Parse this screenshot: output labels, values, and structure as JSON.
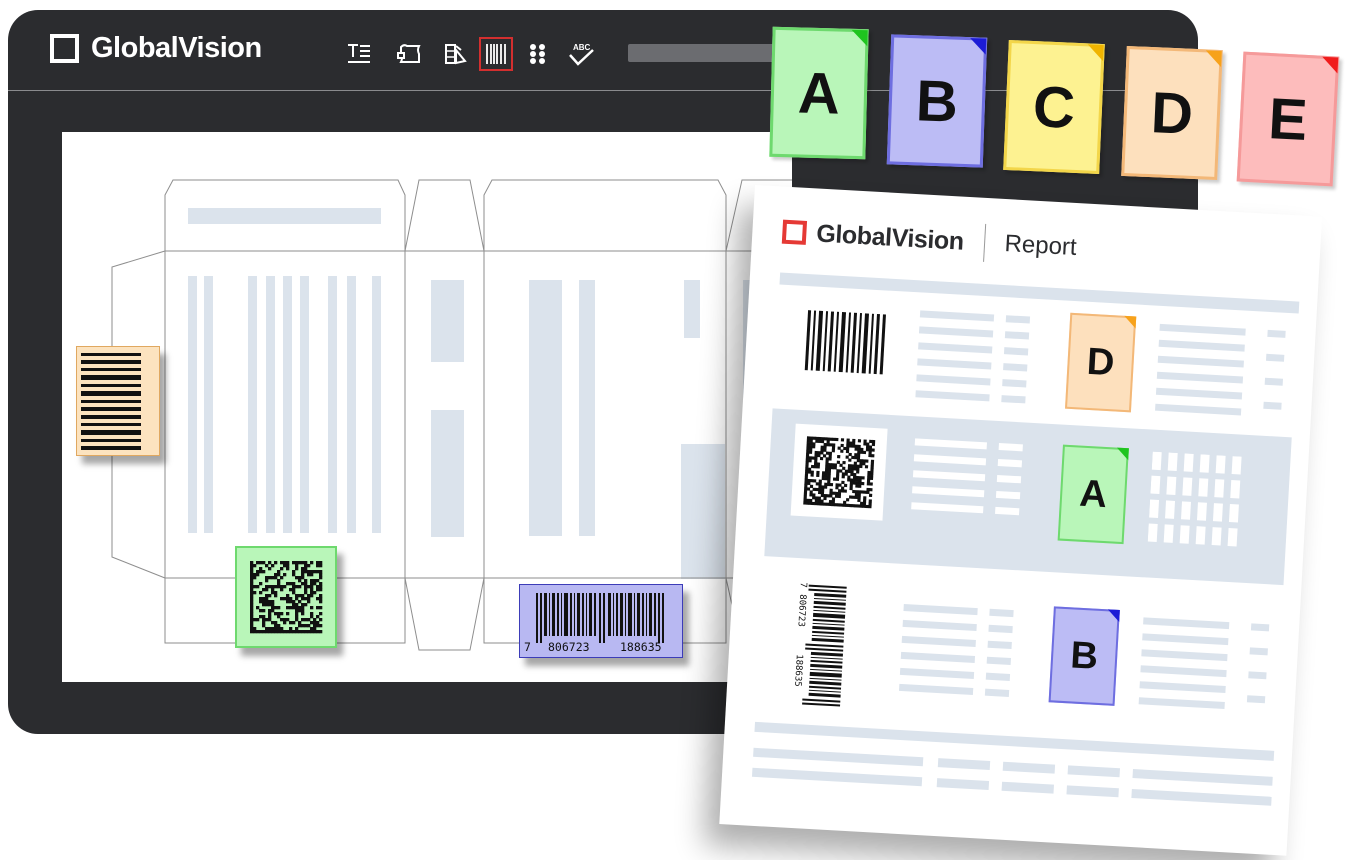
{
  "app": {
    "brand": "GlobalVision",
    "tools": [
      {
        "name": "text-compare-icon"
      },
      {
        "name": "graphics-compare-icon"
      },
      {
        "name": "color-compare-icon"
      },
      {
        "name": "barcode-icon",
        "active": true
      },
      {
        "name": "braille-icon"
      },
      {
        "name": "spell-check-icon"
      }
    ],
    "spellcheck_glyph": "ABC"
  },
  "artwork": {
    "ean_barcode": {
      "first_digit": "7",
      "left_group": "806723",
      "right_group": "188635"
    }
  },
  "grades": [
    {
      "label": "A",
      "fill": "#b9f6b9",
      "border": "#6ed96e",
      "corner": "#1fc41f"
    },
    {
      "label": "B",
      "fill": "#bcbcf5",
      "border": "#6e6ee0",
      "corner": "#1c1cd6"
    },
    {
      "label": "C",
      "fill": "#fdf291",
      "border": "#f3d64a",
      "corner": "#f0b400"
    },
    {
      "label": "D",
      "fill": "#fde0bd",
      "border": "#f3b878",
      "corner": "#f7a21b"
    },
    {
      "label": "E",
      "fill": "#fdbcbc",
      "border": "#f59a9a",
      "corner": "#f01c1c"
    }
  ],
  "report": {
    "brand": "GlobalVision",
    "title": "Report",
    "rows": [
      {
        "grade": "D",
        "symbology": "1d-barcode"
      },
      {
        "grade": "A",
        "symbology": "datamatrix"
      },
      {
        "grade": "B",
        "symbology": "ean-13",
        "digits_left": "806723",
        "digits_right": "188635",
        "first_digit": "7"
      }
    ]
  },
  "colors": {
    "window": "#2b2c2f",
    "placeholder": "#dbe3ec",
    "active_tool": "#d32f2f",
    "report_logo": "#e53935"
  }
}
